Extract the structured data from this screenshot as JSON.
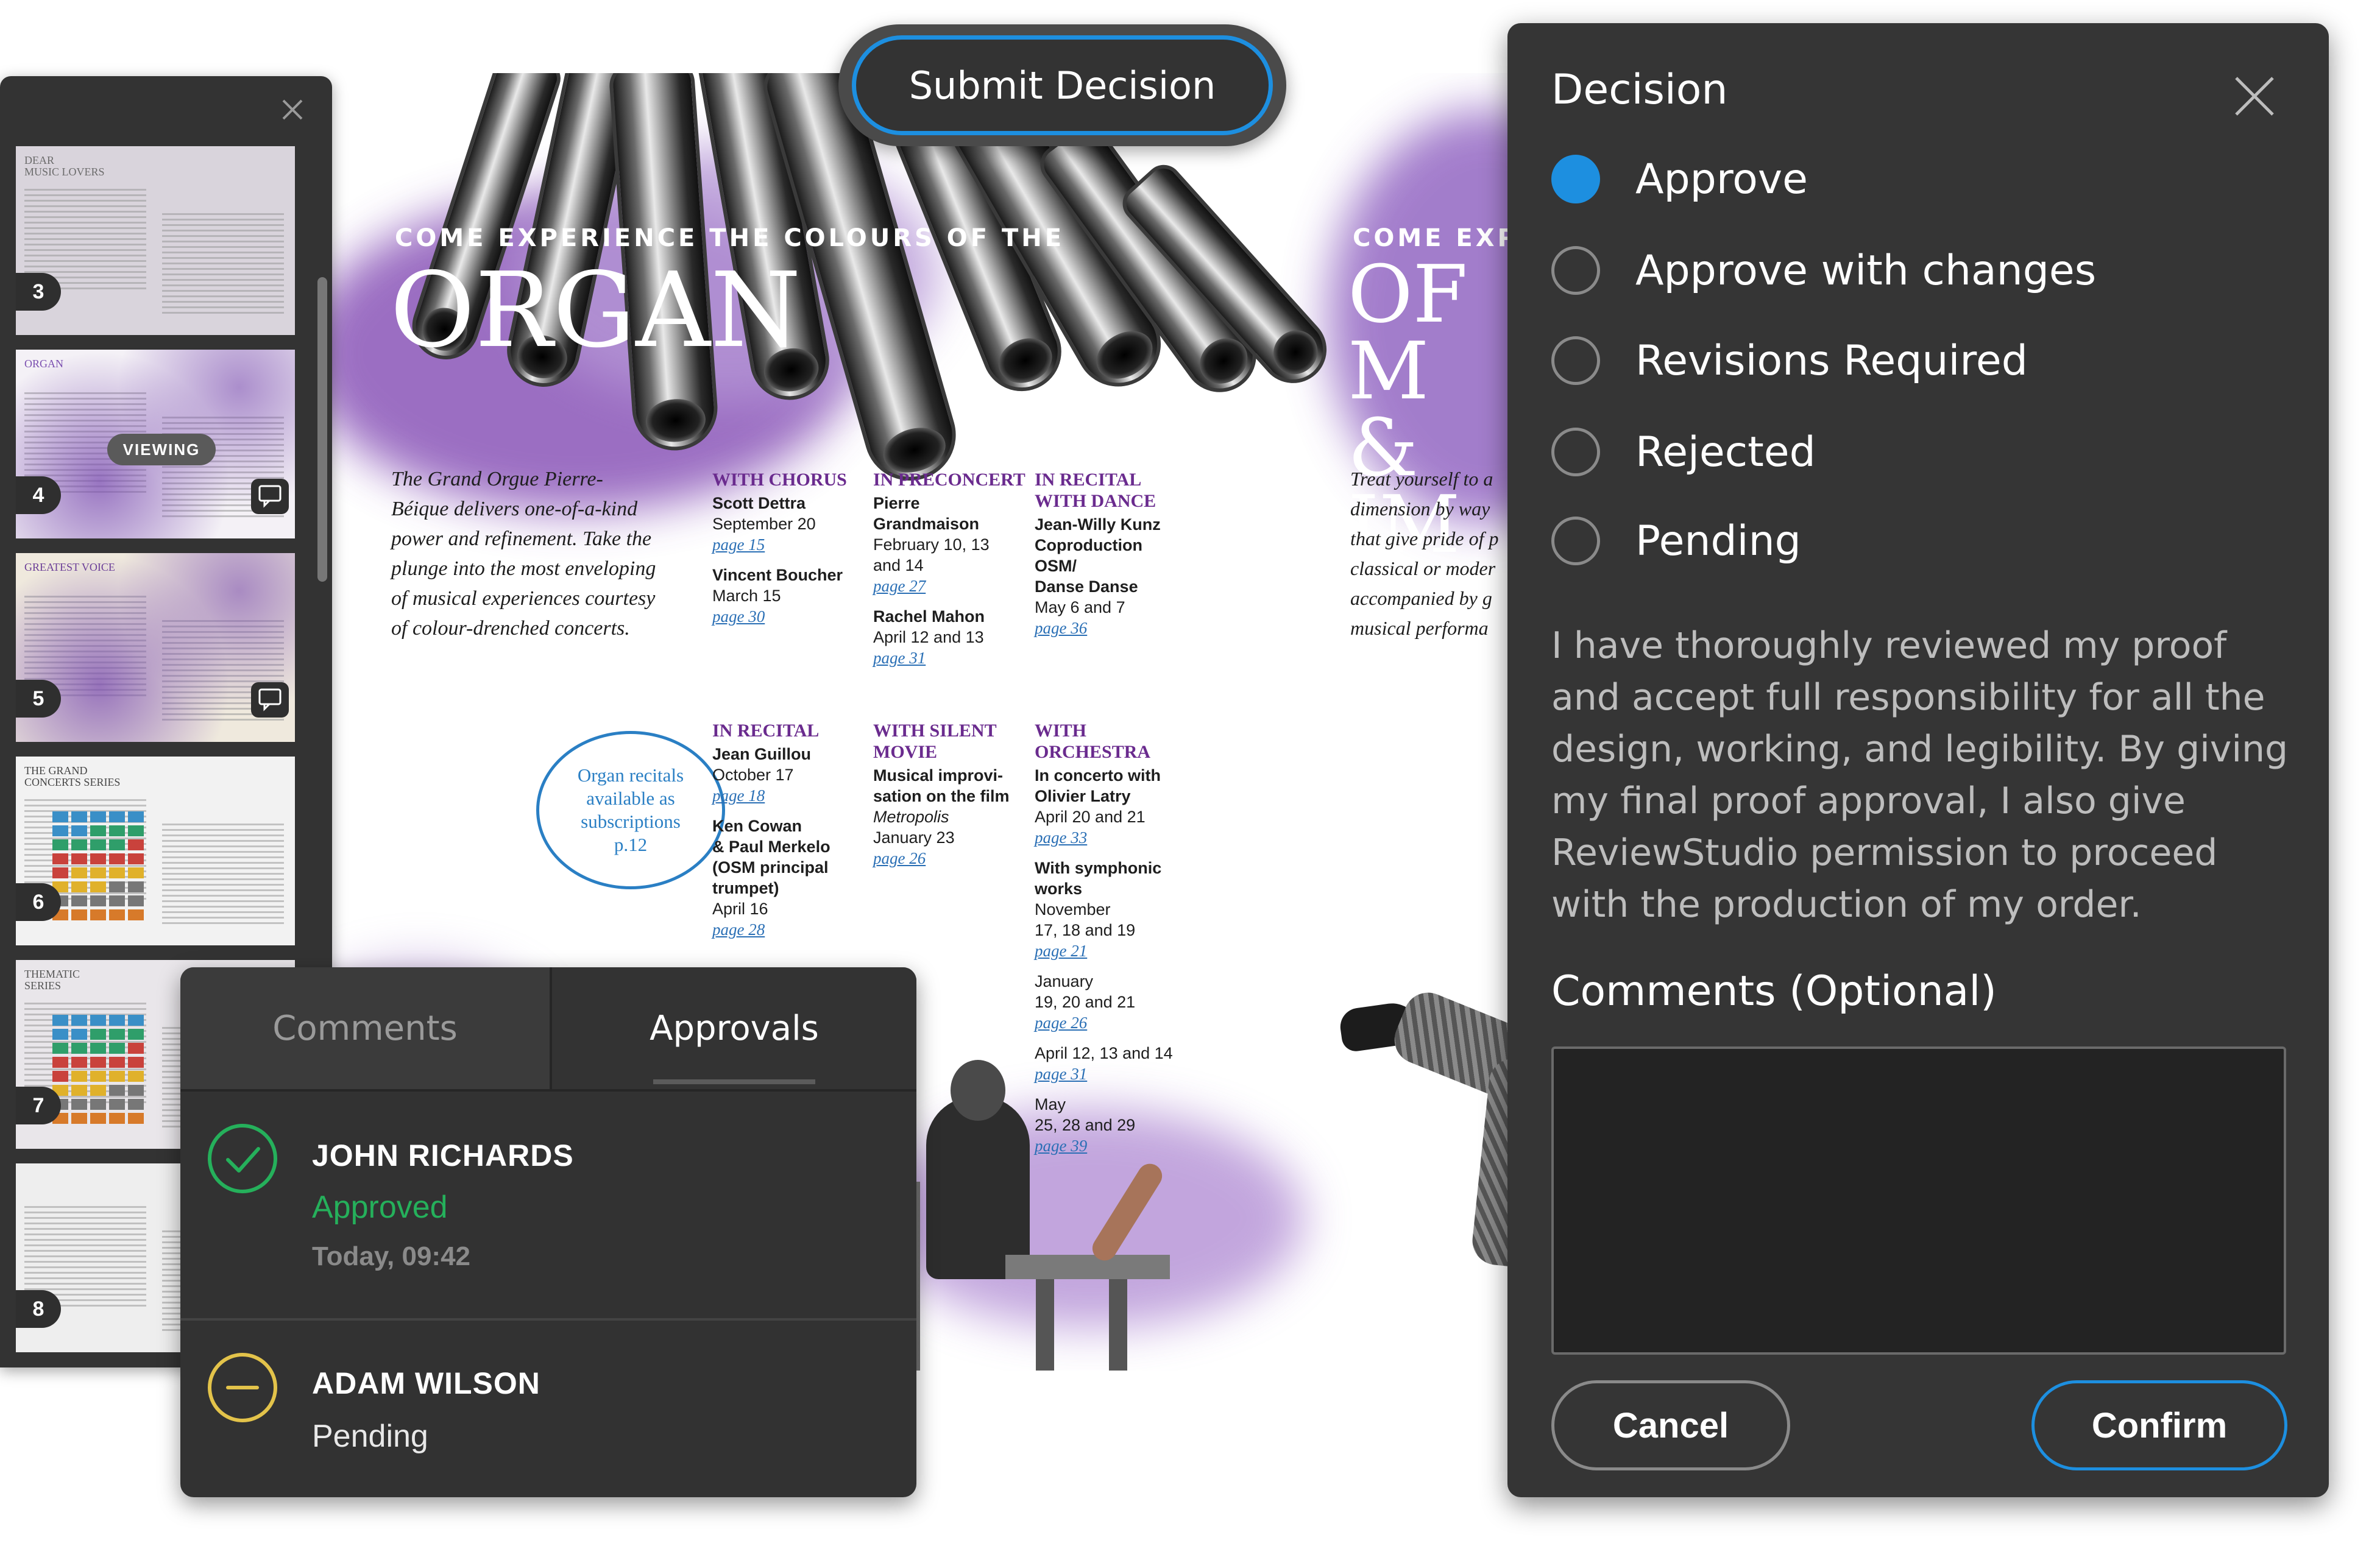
{
  "toolbar": {
    "submit_label": "Submit Decision"
  },
  "document": {
    "left": {
      "kicker": "COME EXPERIENCE THE COLOURS OF THE",
      "title": "ORGAN",
      "intro": "The Grand Orgue Pierre-Béique delivers one-of-a-kind power and refinement. Take the plunge into the most enveloping of musical experiences courtesy of colour-drenched concerts.",
      "callout": "Organ recitals\navailable as\nsubscriptions\np.12"
    },
    "right": {
      "kicker": "COME EXPI",
      "title_line1": "OF M",
      "title_line2": "& IM",
      "intro": "Treat yourself to a dimension by way that give pride of p classical or moder accompanied by g musical performa"
    },
    "events": [
      {
        "heading": "WITH CHORUS",
        "lines": [
          {
            "t": "Scott Dettra",
            "c": "b"
          },
          {
            "t": "September 20",
            "c": ""
          },
          {
            "t": "page 15",
            "c": "pg"
          },
          {
            "t": "Vincent Boucher",
            "c": "b"
          },
          {
            "t": "March 15",
            "c": ""
          },
          {
            "t": "page 30",
            "c": "pg"
          }
        ]
      },
      {
        "heading": "IN PRECONCERT",
        "lines": [
          {
            "t": "Pierre\nGrandmaison",
            "c": "b"
          },
          {
            "t": "February 10, 13\nand 14",
            "c": ""
          },
          {
            "t": "page 27",
            "c": "pg"
          },
          {
            "t": "Rachel Mahon",
            "c": "b"
          },
          {
            "t": "April 12 and 13",
            "c": ""
          },
          {
            "t": "page 31",
            "c": "pg"
          }
        ]
      },
      {
        "heading": "IN RECITAL WITH DANCE",
        "lines": [
          {
            "t": "Jean-Willy Kunz\nCoproduction\nOSM/\nDanse Danse",
            "c": "b"
          },
          {
            "t": "May 6 and 7",
            "c": ""
          },
          {
            "t": "page 36",
            "c": "pg"
          }
        ]
      },
      {
        "heading": "IN RECITAL",
        "lines": [
          {
            "t": "Jean Guillou",
            "c": "b"
          },
          {
            "t": "October 17",
            "c": ""
          },
          {
            "t": "page 18",
            "c": "pg"
          },
          {
            "t": "Ken Cowan\n& Paul Merkelo\n(OSM principal\ntrumpet)",
            "c": "b"
          },
          {
            "t": "April 16",
            "c": ""
          },
          {
            "t": "page 28",
            "c": "pg"
          }
        ]
      },
      {
        "heading": "WITH SILENT MOVIE",
        "lines": [
          {
            "t": "Musical improvi-\nsation on the film",
            "c": "b"
          },
          {
            "t": "Metropolis",
            "c": "i"
          },
          {
            "t": "January 23",
            "c": ""
          },
          {
            "t": "page 26",
            "c": "pg"
          }
        ]
      },
      {
        "heading": "WITH ORCHESTRA",
        "lines": [
          {
            "t": "In concerto with\nOlivier Latry",
            "c": "b"
          },
          {
            "t": "April 20 and 21",
            "c": ""
          },
          {
            "t": "page 33",
            "c": "pg"
          },
          {
            "t": "With symphonic\nworks",
            "c": "b"
          },
          {
            "t": "November\n17, 18 and 19",
            "c": ""
          },
          {
            "t": "page 21",
            "c": "pg"
          },
          {
            "t": "January\n19, 20 and 21",
            "c": ""
          },
          {
            "t": "page 26",
            "c": "pg"
          },
          {
            "t": "April 12, 13 and 14",
            "c": ""
          },
          {
            "t": "page 31",
            "c": "pg"
          },
          {
            "t": "May\n25, 28 and 29",
            "c": ""
          },
          {
            "t": "page 39",
            "c": "pg"
          }
        ]
      }
    ]
  },
  "thumbnails": [
    {
      "page": "3",
      "title": "DEAR\nMUSIC LOVERS",
      "viewing": false,
      "comment": false
    },
    {
      "page": "4",
      "title": "ORGAN",
      "viewing": true,
      "viewing_label": "VIEWING",
      "comment": true
    },
    {
      "page": "5",
      "title": "GREATEST VOICE",
      "viewing": false,
      "comment": true
    },
    {
      "page": "6",
      "title": "THE GRAND\nCONCERTS SERIES",
      "viewing": false,
      "comment": false
    },
    {
      "page": "7",
      "title": "THEMATIC\nSERIES",
      "viewing": false,
      "comment": false
    },
    {
      "page": "8",
      "title": "",
      "viewing": false,
      "comment": false
    }
  ],
  "approvals_panel": {
    "tabs": [
      {
        "label": "Comments",
        "active": false
      },
      {
        "label": "Approvals",
        "active": true
      }
    ],
    "approvers": [
      {
        "name": "JOHN RICHARDS",
        "status": "Approved",
        "time": "Today, 09:42",
        "status_color": "#25b05b",
        "icon": "check-circle-icon"
      },
      {
        "name": "ADAM WILSON",
        "status": "Pending",
        "time": "",
        "status_color": "#e3c34a",
        "icon": "minus-circle-icon"
      }
    ]
  },
  "decision_modal": {
    "title": "Decision",
    "options": [
      {
        "label": "Approve",
        "selected": true
      },
      {
        "label": "Approve with changes",
        "selected": false
      },
      {
        "label": "Revisions Required",
        "selected": false
      },
      {
        "label": "Rejected",
        "selected": false
      },
      {
        "label": "Pending",
        "selected": false
      }
    ],
    "terms": "I have thoroughly reviewed my proof and accept full responsibility for all the design, working, and legibility. By giving my final proof approval, I also give ReviewStudio permission to proceed with the production of my order.",
    "comments_label": "Comments (Optional)",
    "comments_value": "",
    "cancel_label": "Cancel",
    "confirm_label": "Confirm"
  },
  "colors": {
    "accent": "#1d8fe0",
    "approved": "#25b05b",
    "pending": "#e3c34a",
    "panel_bg": "#353535",
    "brand_purple": "#6a2b8e"
  }
}
